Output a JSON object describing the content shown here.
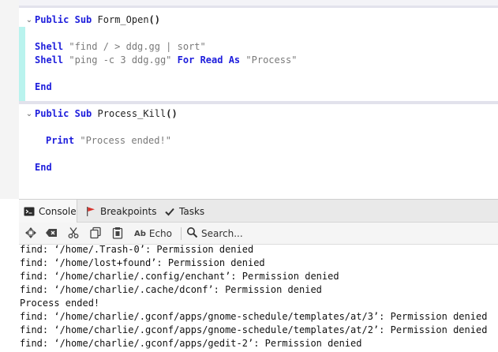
{
  "editor": {
    "sub1": {
      "keyword1": "Public",
      "keyword2": "Sub",
      "name": "Form_Open",
      "parens": "()",
      "fold": "⌄"
    },
    "line_shell1": {
      "keyword": "Shell",
      "arg": "\"find / > ddg.gg | sort\""
    },
    "line_shell2": {
      "keyword": "Shell",
      "arg": "\"ping -c 3 ddg.gg\"",
      "kw_for": "For",
      "kw_read": "Read",
      "kw_as": "As",
      "arg2": "\"Process\""
    },
    "end1": "End",
    "sub2": {
      "keyword1": "Public",
      "keyword2": "Sub",
      "name": "Process_Kill",
      "parens": "()",
      "fold": "⌄"
    },
    "line_print": {
      "keyword": "Print",
      "arg": "\"Process ended!\""
    },
    "end2": "End"
  },
  "tabs": [
    {
      "label": "Console",
      "icon": "console-icon",
      "active": true
    },
    {
      "label": "Breakpoints",
      "icon": "flag-icon",
      "active": false
    },
    {
      "label": "Tasks",
      "icon": "check-icon",
      "active": false
    }
  ],
  "toolbar": {
    "echo_label": "Echo",
    "echo_icon_text": "Ab",
    "search_label": "Search...",
    "icons": [
      "navigate-icon",
      "clear-icon",
      "cut-icon",
      "copy-icon",
      "paste-icon",
      "echo-icon",
      "search-icon"
    ]
  },
  "console": {
    "lines": [
      "find: ‘/home/.Trash-0’: Permission denied",
      "find: ‘/home/lost+found’: Permission denied",
      "find: ‘/home/charlie/.config/enchant’: Permission denied",
      "find: ‘/home/charlie/.cache/dconf’: Permission denied",
      "Process ended!",
      "find: ‘/home/charlie/.gconf/apps/gnome-schedule/templates/at/3’: Permission denied",
      "find: ‘/home/charlie/.gconf/apps/gnome-schedule/templates/at/2’: Permission denied",
      "find: ‘/home/charlie/.gconf/apps/gedit-2’: Permission denied"
    ]
  },
  "colors": {
    "keyword": "#1d1ddc",
    "string": "#7a7a7a",
    "change_bar": "#b9f3ee",
    "separator": "#e2e2ec"
  }
}
